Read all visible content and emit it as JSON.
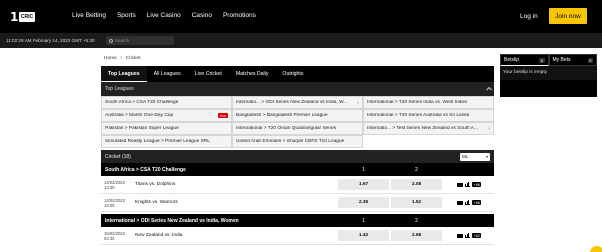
{
  "header": {
    "logo_digit": "1",
    "logo_word": "CRIC",
    "nav": [
      "Live Betting",
      "Sports",
      "Live Casino",
      "Casino",
      "Promotions"
    ],
    "login_label": "Log in",
    "join_label": "Join now"
  },
  "subbar": {
    "clock": "11:02:29 AM February 14, 2022 GMT +5:30",
    "search_placeholder": "Search"
  },
  "breadcrumb": [
    "Home",
    ">",
    "Cricket"
  ],
  "tabs": [
    "Top Leagues",
    "All Leagues",
    "Live Cricket",
    "Matches Daily",
    "Outrights"
  ],
  "top_leagues": {
    "title": "Top Leagues",
    "cells": [
      "South Africa > CSA T20 Challenge",
      "Internatio... > ODI Series New Zealand vs India, W...",
      "International > T20 Series India vs. West Indies",
      "Australia > Marsh One-Day Cup",
      "Bangladesh > Bangladesh Premier League",
      "International > T20 Series Australia vs Sri Lanka",
      "Pakistan > Pakistan Super League",
      "International > T20 Oman Quadrangular Series",
      "Internatio... > Test Series New Zealand vs South A...",
      "Simulated Reality League > Premier League SRL",
      "United Arab Emirates > Sharjah CBFS T10 League",
      ""
    ],
    "live_badge": "Live"
  },
  "cricket_section": {
    "title": "Cricket (18)",
    "market": "ML"
  },
  "competitions": [
    {
      "name": "South Africa > CSA T20 Challenge",
      "col1": "1",
      "col2": "2",
      "events": [
        {
          "date": "14/02/2022",
          "time": "13:30",
          "teams": "Titans vs. Dolphins",
          "odd1": "1.67",
          "odd2": "2.08",
          "more": "+86"
        },
        {
          "date": "14/02/2022",
          "time": "18:00",
          "teams": "Knights vs. Warriors",
          "odd1": "2.35",
          "odd2": "1.52",
          "more": "+86"
        }
      ]
    },
    {
      "name": "International > ODI Series New Zealand vs India, Women",
      "col1": "1",
      "col2": "2",
      "events": [
        {
          "date": "15/02/2022",
          "time": "03:30",
          "teams": "New Zealand vs. India",
          "odd1": "1.42",
          "odd2": "2.68",
          "more": "+82"
        }
      ]
    }
  ],
  "betslip": {
    "tab1": "Betslip",
    "tab1_count": "0",
    "tab2": "My Bets",
    "tab2_count": "0",
    "empty_text": "Your betslip is empty"
  },
  "colors": {
    "accent": "#f7c600",
    "header_bg": "#000000",
    "live_red": "#dd0000"
  }
}
